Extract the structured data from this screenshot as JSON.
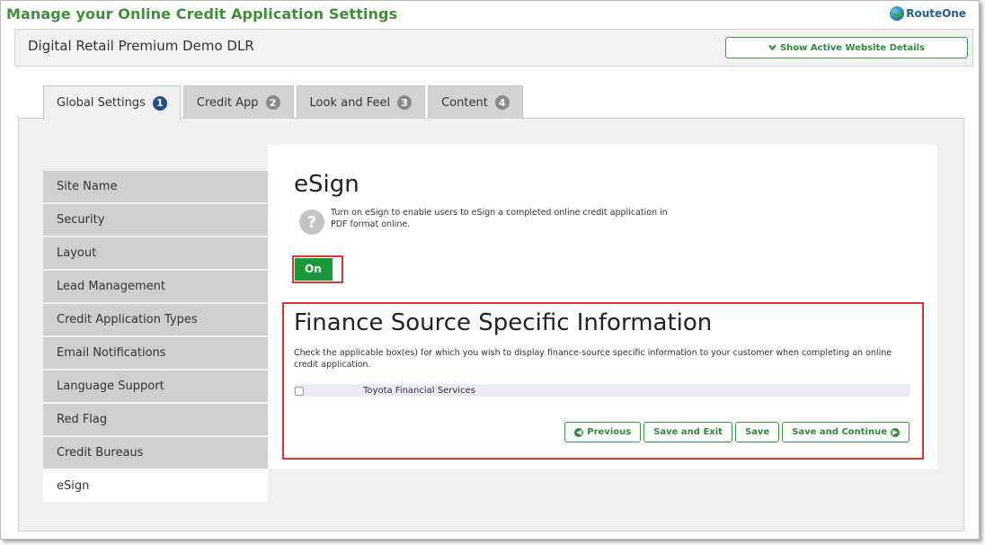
{
  "header": {
    "title": "Manage your Online Credit Application Settings",
    "brand": "RouteOne",
    "dealer_name": "Digital Retail Premium Demo DLR",
    "active_details_label": "Show Active Website Details",
    "active_details_icon": "chevron-down-icon"
  },
  "tabs": [
    {
      "label": "Global Settings",
      "badge": "1",
      "active": true
    },
    {
      "label": "Credit App",
      "badge": "2",
      "active": false
    },
    {
      "label": "Look and Feel",
      "badge": "3",
      "active": false
    },
    {
      "label": "Content",
      "badge": "4",
      "active": false
    }
  ],
  "sidebar": {
    "items": [
      {
        "label": "Site Name"
      },
      {
        "label": "Security"
      },
      {
        "label": "Layout"
      },
      {
        "label": "Lead Management"
      },
      {
        "label": "Credit Application Types"
      },
      {
        "label": "Email Notifications"
      },
      {
        "label": "Language Support"
      },
      {
        "label": "Red Flag"
      },
      {
        "label": "Credit Bureaus"
      },
      {
        "label": "eSign",
        "active": true
      }
    ]
  },
  "esign": {
    "title": "eSign",
    "help_icon": "question-icon",
    "help_text": "Turn on eSign to enable users to eSign a completed online credit application in PDF format online.",
    "toggle_label": "On"
  },
  "finance_source": {
    "title": "Finance Source Specific Information",
    "description": "Check the applicable box(es) for which you wish to display finance-source specific information to your customer when completing an online credit application.",
    "rows": [
      {
        "label": "Toyota Financial Services",
        "checked": false
      }
    ]
  },
  "actions": {
    "previous": "Previous",
    "save_exit": "Save and Exit",
    "save": "Save",
    "save_continue": "Save and Continue"
  },
  "colors": {
    "accent_green": "#2f8a3a",
    "title_green": "#3f8f3a",
    "toggle_on": "#1a9a3c",
    "highlight_red": "#dd3333",
    "active_badge": "#1f4e8a"
  }
}
